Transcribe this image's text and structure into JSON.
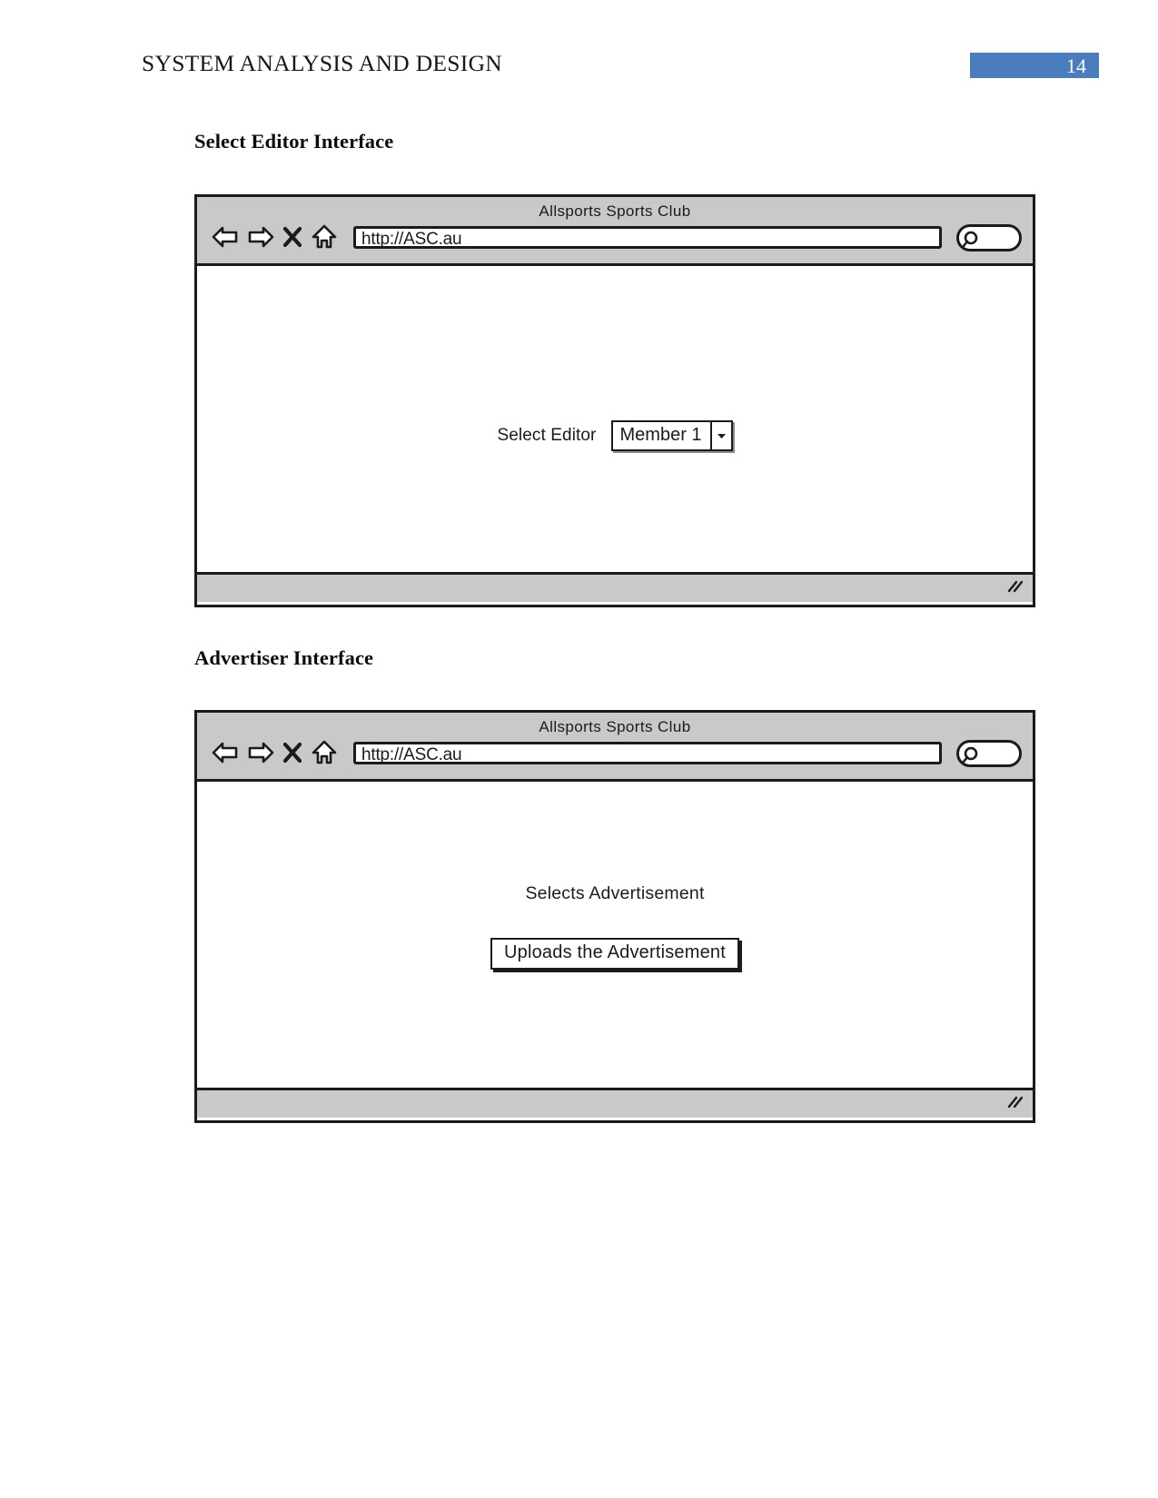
{
  "header": {
    "running_title": "SYSTEM ANALYSIS AND DESIGN",
    "page_number": "14",
    "badge_color": "#4a7dbd"
  },
  "sections": [
    {
      "heading": "Select Editor Interface",
      "mockup": {
        "window_title": "Allsports Sports Club",
        "url_value": "http://ASC.au",
        "nav_icons": [
          "back-arrow-icon",
          "forward-arrow-icon",
          "close-x-icon",
          "home-icon"
        ],
        "search_icon": "search-magnifier-icon",
        "resize_grip": "resize-grip-icon",
        "content": {
          "field_label": "Select Editor",
          "select_value": "Member 1",
          "select_arrow": "chevron-down-icon"
        }
      }
    },
    {
      "heading": "Advertiser Interface",
      "mockup": {
        "window_title": "Allsports Sports Club",
        "url_value": "http://ASC.au",
        "nav_icons": [
          "back-arrow-icon",
          "forward-arrow-icon",
          "close-x-icon",
          "home-icon"
        ],
        "search_icon": "search-magnifier-icon",
        "resize_grip": "resize-grip-icon",
        "content": {
          "static_text": "Selects Advertisement",
          "button_label": "Uploads the Advertisement"
        }
      }
    }
  ]
}
